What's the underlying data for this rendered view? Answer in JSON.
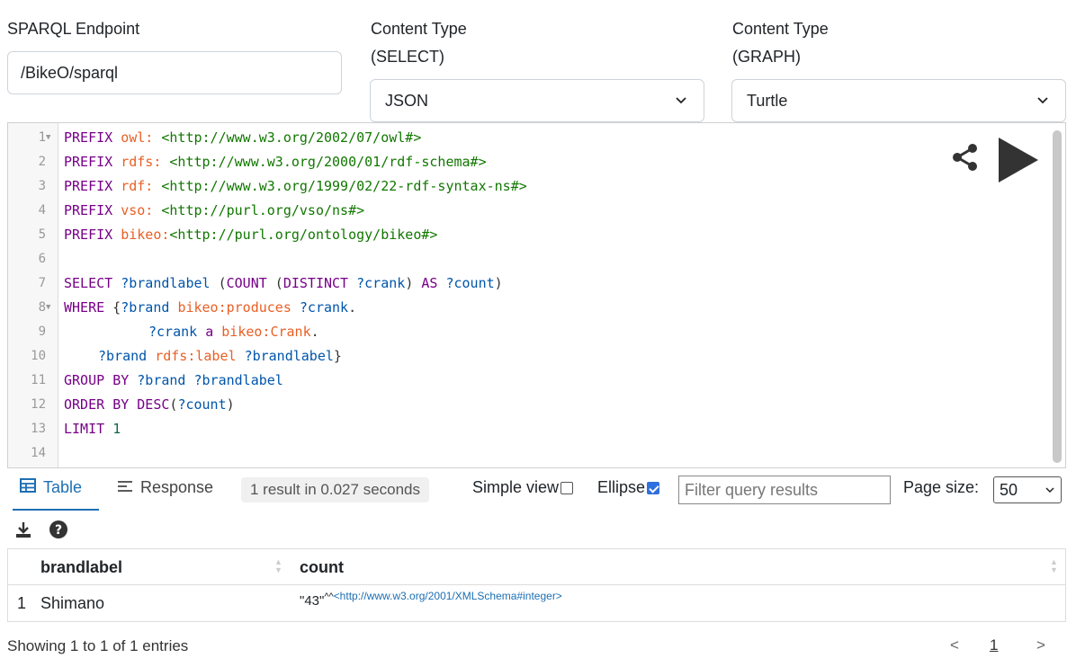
{
  "endpoint": {
    "label": "SPARQL Endpoint",
    "value": "/BikeO/sparql"
  },
  "content_type_select": {
    "label_line1": "Content Type",
    "label_line2": "(SELECT)",
    "value": "JSON"
  },
  "content_type_graph": {
    "label_line1": "Content Type",
    "label_line2": "(GRAPH)",
    "value": "Turtle"
  },
  "editor": {
    "line_numbers": [
      "1",
      "2",
      "3",
      "4",
      "5",
      "6",
      "7",
      "8",
      "9",
      "10",
      "11",
      "12",
      "13",
      "14"
    ],
    "lines": [
      "PREFIX owl: <http://www.w3.org/2002/07/owl#>",
      "PREFIX rdfs: <http://www.w3.org/2000/01/rdf-schema#>",
      "PREFIX rdf: <http://www.w3.org/1999/02/22-rdf-syntax-ns#>",
      "PREFIX vso: <http://purl.org/vso/ns#>",
      "PREFIX bikeo:<http://purl.org/ontology/bikeo#>",
      "",
      "SELECT ?brandlabel (COUNT (DISTINCT ?crank) AS ?count)",
      "WHERE {?brand bikeo:produces ?crank.",
      "       ?crank a bikeo:Crank.",
      "   ?brand rdfs:label ?brandlabel}",
      "GROUP BY ?brand ?brandlabel",
      "ORDER BY DESC(?count)",
      "LIMIT 1",
      ""
    ],
    "share_icon": "share-icon",
    "run_icon": "play-icon"
  },
  "results_toolbar": {
    "tab_table": "Table",
    "tab_response": "Response",
    "result_summary": "1 result in 0.027 seconds",
    "simple_view_label": "Simple view",
    "simple_view_checked": false,
    "ellipse_label": "Ellipse",
    "ellipse_checked": true,
    "filter_placeholder": "Filter query results",
    "page_size_label": "Page size:",
    "page_size_value": "50"
  },
  "tools": {
    "download_icon": "download-icon",
    "help_icon": "help-icon"
  },
  "table": {
    "columns": [
      "brandlabel",
      "count"
    ],
    "rows": [
      {
        "index": "1",
        "brandlabel": "Shimano",
        "count_literal": "\"43\"",
        "count_hat": "^^",
        "count_datatype": "<http://www.w3.org/2001/XMLSchema#integer>"
      }
    ]
  },
  "footer": {
    "info": "Showing 1 to 1 of 1 entries",
    "prev": "<",
    "page": "1",
    "next": ">"
  },
  "colors": {
    "accent": "#1d6fb3",
    "keyword": "#770088",
    "prefix": "#e95f24",
    "uri": "#117700",
    "variable": "#0055aa"
  }
}
